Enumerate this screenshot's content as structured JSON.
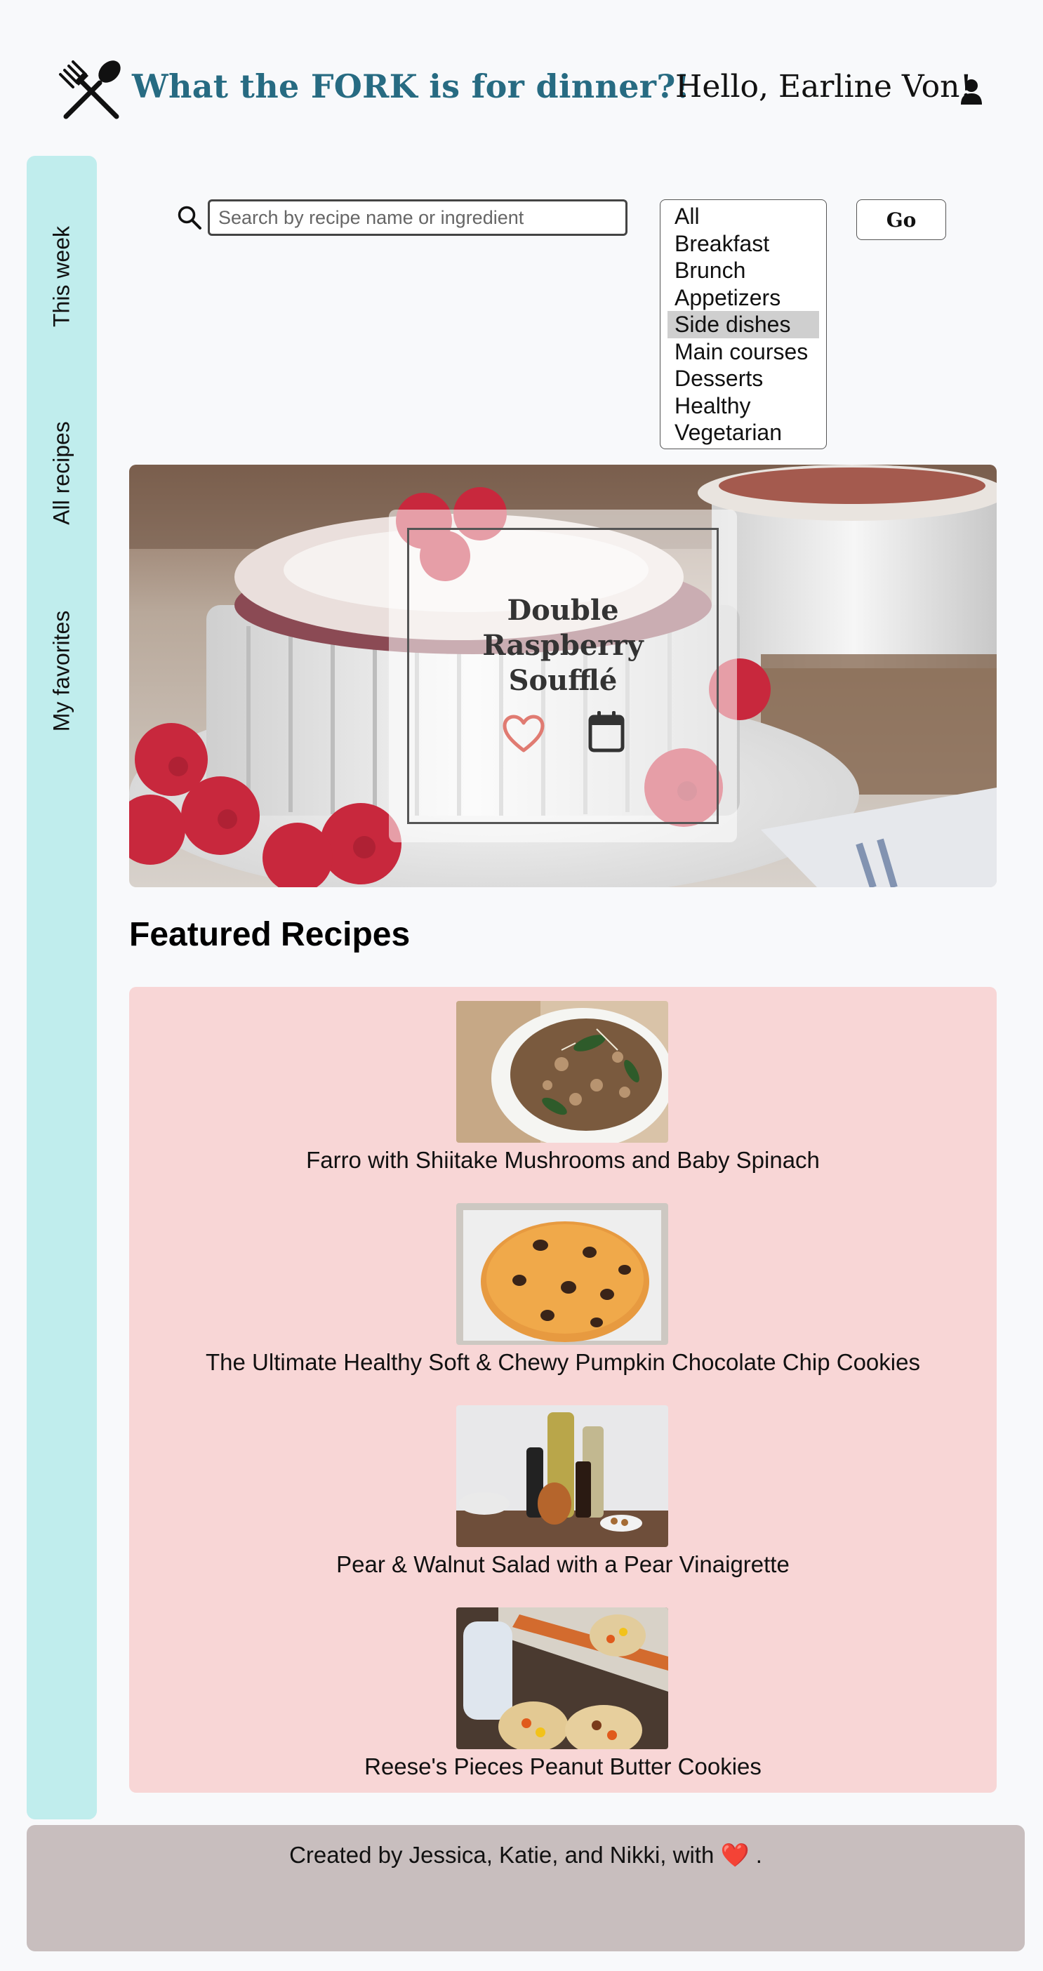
{
  "header": {
    "site_title": "What the FORK is for dinner?!",
    "greeting": "Hello, Earline Von!"
  },
  "sidebar": {
    "items": [
      {
        "label": "This week"
      },
      {
        "label": "All recipes"
      },
      {
        "label": "My favorites"
      }
    ]
  },
  "search": {
    "placeholder": "Search by recipe name or ingredient",
    "value": "",
    "go_label": "Go",
    "categories": [
      "All",
      "Breakfast",
      "Brunch",
      "Appetizers",
      "Side dishes",
      "Main courses",
      "Desserts",
      "Healthy",
      "Vegetarian"
    ],
    "selected_category": "Side dishes"
  },
  "hero": {
    "title_lines": [
      "Double",
      "Raspberry",
      "Soufflé"
    ]
  },
  "featured": {
    "heading": "Featured Recipes",
    "recipes": [
      {
        "name": "Farro with Shiitake Mushrooms and Baby Spinach"
      },
      {
        "name": "The Ultimate Healthy Soft & Chewy Pumpkin Chocolate Chip Cookies"
      },
      {
        "name": "Pear & Walnut Salad with a Pear Vinaigrette"
      },
      {
        "name": "Reese's Pieces Peanut Butter Cookies"
      }
    ]
  },
  "footer": {
    "text": "Created by Jessica, Katie, and Nikki, with",
    "heart": "❤️",
    "end": "."
  },
  "colors": {
    "brand": "#276b82",
    "sidebar": "#c0eded",
    "featured_panel": "#f8d6d6",
    "footer": "#c8bebe",
    "heart": "#e07b72"
  }
}
